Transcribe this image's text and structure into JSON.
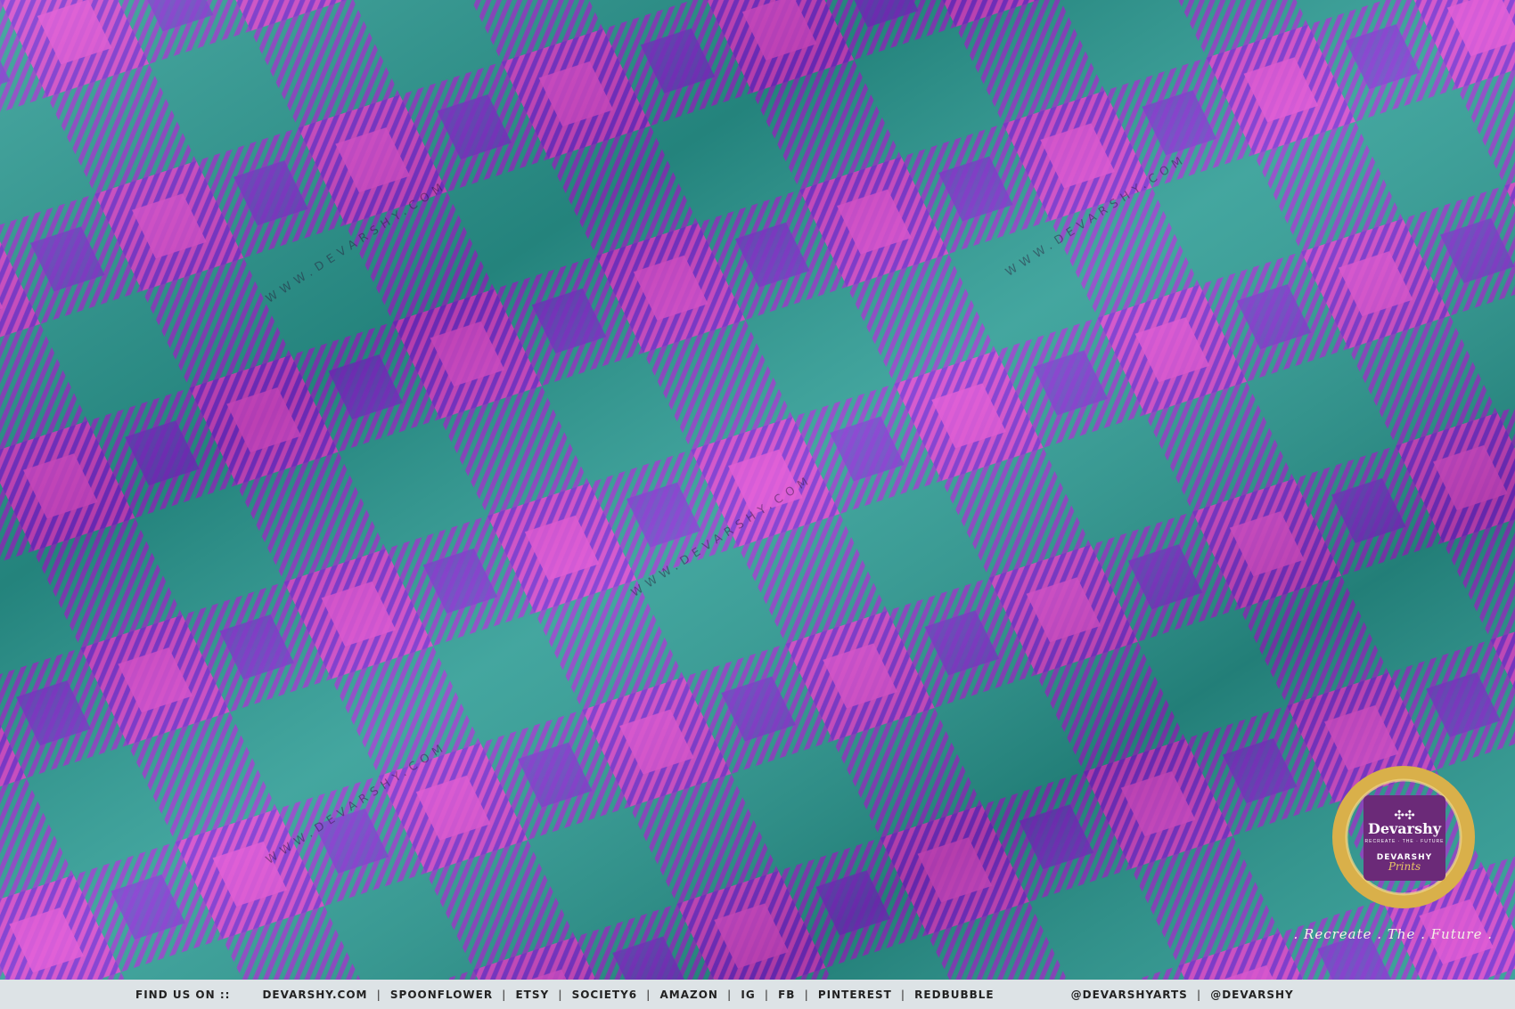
{
  "image": {
    "subject": "satin fabric with plaid pattern",
    "colors": {
      "teal": "#2a9a92",
      "pink": "#e04bd4",
      "violet": "#7a2fd0",
      "stripe": "#8a3fc4"
    }
  },
  "watermarks": [
    "WWW.DEVARSHY.COM",
    "WWW.DEVARSHY.COM",
    "WWW.DEVARSHY.COM",
    "WWW.DEVARSHY.COM"
  ],
  "badge": {
    "logo": "Devarshy",
    "tagline_small": "RECREATE · THE · FUTURE",
    "sub": "DEVARSHY",
    "script": "Prints"
  },
  "tagline": ". Recreate . The . Future .",
  "footer": {
    "label": "FIND US ON ::",
    "links": [
      "DEVARSHY.COM",
      "SPOONFLOWER",
      "ETSY",
      "SOCIETY6",
      "AMAZON",
      "IG",
      "FB",
      "PINTEREST",
      "REDBUBBLE"
    ],
    "handle_1": "@DEVARSHYARTS",
    "handle_2": "@DEVARSHY"
  }
}
